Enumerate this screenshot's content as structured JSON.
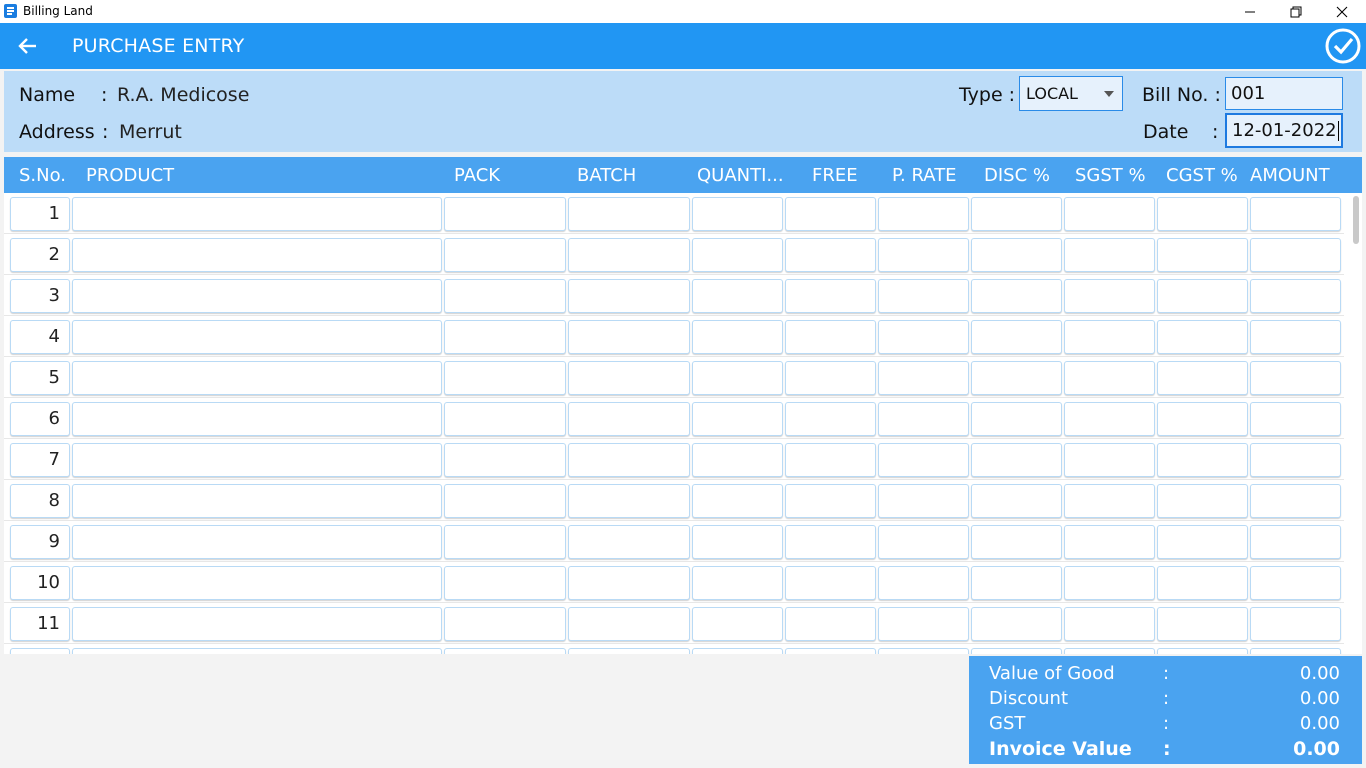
{
  "window": {
    "title": "Billing Land"
  },
  "appbar": {
    "title": "PURCHASE ENTRY"
  },
  "header": {
    "name_label": "Name",
    "name_colon": ":",
    "name_value": "R.A. Medicose",
    "address_label": "Address",
    "address_colon": ":",
    "address_value": "Merrut",
    "type_label": "Type :",
    "type_value": "LOCAL",
    "bill_label": "Bill No. :",
    "bill_value": "001",
    "date_label": "Date",
    "date_colon": ":",
    "date_value": "12-01-2022"
  },
  "grid": {
    "columns": [
      "S.No.",
      "PRODUCT",
      "PACK",
      "BATCH",
      "QUANTI...",
      "FREE",
      "P. RATE",
      "DISC %",
      "SGST %",
      "CGST %",
      "AMOUNT"
    ],
    "rows": [
      {
        "sno": "1"
      },
      {
        "sno": "2"
      },
      {
        "sno": "3"
      },
      {
        "sno": "4"
      },
      {
        "sno": "5"
      },
      {
        "sno": "6"
      },
      {
        "sno": "7"
      },
      {
        "sno": "8"
      },
      {
        "sno": "9"
      },
      {
        "sno": "10"
      },
      {
        "sno": "11"
      },
      {
        "sno": ""
      }
    ]
  },
  "totals": {
    "value_of_good_label": "Value of Good",
    "value_of_good": "0.00",
    "discount_label": "Discount",
    "discount": "0.00",
    "gst_label": "GST",
    "gst": "0.00",
    "invoice_value_label": "Invoice Value",
    "invoice_value": "0.00",
    "colon": ":"
  },
  "colors": {
    "appbar": "#2196f3",
    "header_panel": "#bcdcf8",
    "grid_header": "#4aa3f0",
    "totals_panel": "#4aa3f0"
  }
}
